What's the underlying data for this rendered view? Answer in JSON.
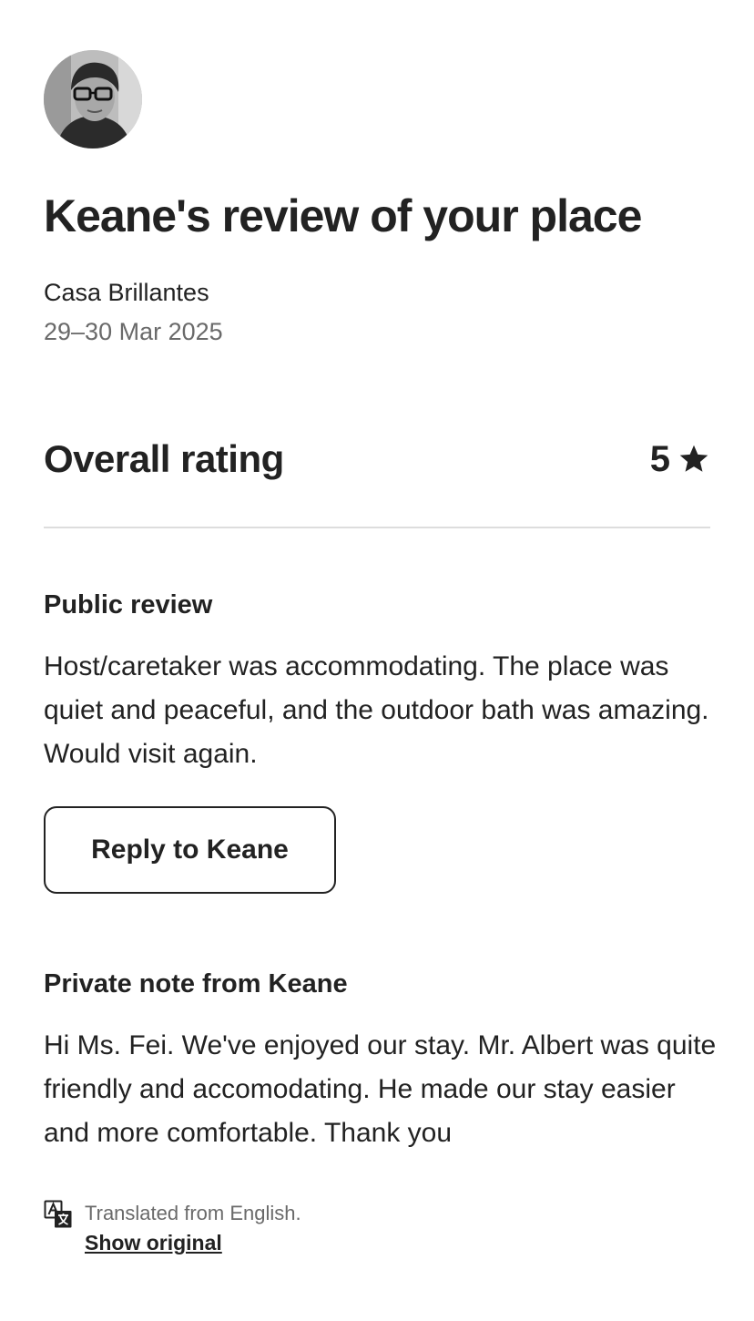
{
  "header": {
    "title": "Keane's review of your place",
    "listing_name": "Casa Brillantes",
    "stay_dates": "29–30 Mar 2025"
  },
  "rating": {
    "label": "Overall rating",
    "value": "5",
    "icon": "star-icon"
  },
  "public_review": {
    "heading": "Public review",
    "text": "Host/caretaker was accommodating. The place was quiet and peaceful, and the outdoor bath was amazing. Would visit again.",
    "reply_button_label": "Reply to Keane"
  },
  "private_note": {
    "heading": "Private note from Keane",
    "text": "Hi Ms. Fei. We've enjoyed our stay. Mr. Albert was quite friendly and accomodating. He made our stay easier and more comfortable. Thank you"
  },
  "translation": {
    "icon": "translate-icon",
    "note": "Translated from English.",
    "show_original_label": "Show original"
  },
  "colors": {
    "text_primary": "#222222",
    "text_secondary": "#6a6a6a",
    "divider": "#dddddd"
  }
}
